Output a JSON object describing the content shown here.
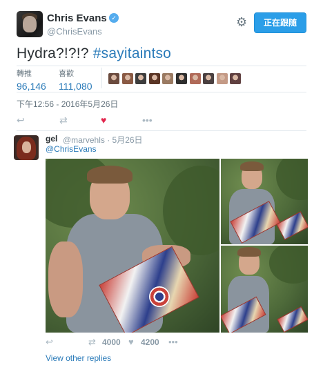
{
  "author": {
    "name": "Chris Evans",
    "handle": "@ChrisEvans",
    "follow_label": "正在跟随"
  },
  "tweet": {
    "text_plain": "Hydra?!?!? ",
    "hashtag": "#sayitaintso",
    "timestamp": "下午12:56 - 2016年5月26日"
  },
  "stats": {
    "retweets_label": "轉推",
    "retweets_value": "96,146",
    "likes_label": "喜歡",
    "likes_value": "111,080"
  },
  "liker_avatars": [
    "#6b4b3e",
    "#8a5a44",
    "#3d3d3d",
    "#5a3525",
    "#9a7a62",
    "#2e2e2e",
    "#b06a58",
    "#4a4040",
    "#c49a86",
    "#604040"
  ],
  "icons": {
    "reply": "reply-icon",
    "retweet": "retweet-icon",
    "like": "heart-icon",
    "more": "more-icon",
    "settings": "gear-icon",
    "verified": "verified-badge-icon"
  },
  "reply": {
    "name": "gel",
    "meta": "@marvehls · 5月26日",
    "mention": "@ChrisEvans",
    "retweet_count": "4000",
    "like_count": "4200"
  },
  "view_replies_label": "View other replies",
  "colors": {
    "follow_button": "#2b9ee8",
    "link": "#2b7bb9",
    "like_active": "#e2264d"
  }
}
